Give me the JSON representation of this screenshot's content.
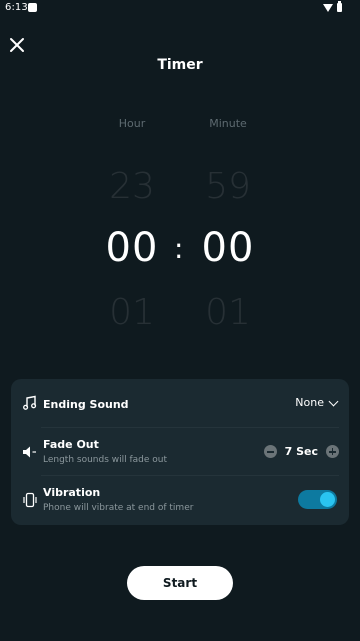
{
  "status_bar": {
    "time": "6:13"
  },
  "header": {
    "title": "Timer"
  },
  "picker": {
    "hour": {
      "label": "Hour",
      "prev": "23",
      "current": "00",
      "next": "01"
    },
    "minute": {
      "label": "Minute",
      "prev": "59",
      "current": "00",
      "next": "01"
    },
    "separator": ":"
  },
  "settings": {
    "ending_sound": {
      "title": "Ending Sound",
      "value": "None"
    },
    "fade_out": {
      "title": "Fade Out",
      "subtitle": "Length sounds will fade out",
      "value": "7 Sec"
    },
    "vibration": {
      "title": "Vibration",
      "subtitle": "Phone will vibrate at end of timer",
      "enabled": true
    }
  },
  "actions": {
    "start_label": "Start"
  },
  "colors": {
    "background": "#0f1a1f",
    "card": "#1b2a31",
    "accent": "#2ac4f0",
    "toggle_track": "#0d7aa0"
  },
  "icons": [
    "close-icon",
    "music-note-icon",
    "speaker-icon",
    "vibration-icon",
    "chevron-down-icon",
    "minus-icon",
    "plus-icon"
  ]
}
